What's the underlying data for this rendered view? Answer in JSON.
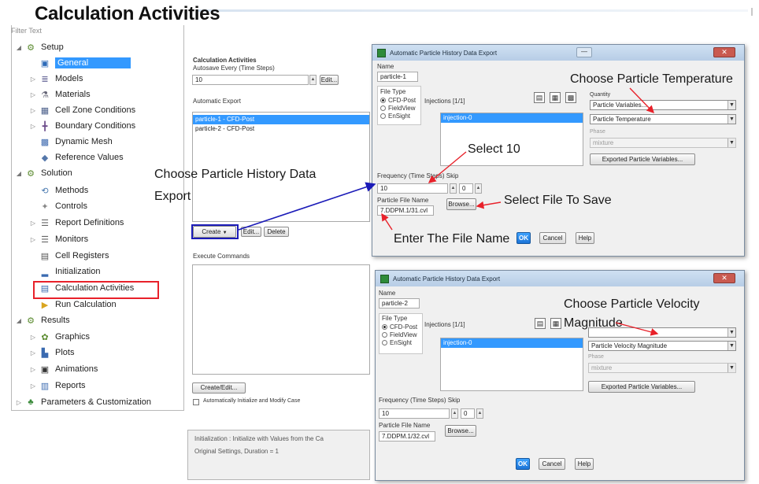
{
  "slide": {
    "title": "Calculation Activities"
  },
  "tree": {
    "filter_text": "Filter Text",
    "items": [
      {
        "label": "Setup",
        "icon": "setup-icon"
      },
      {
        "label": "General",
        "icon": "general-icon"
      },
      {
        "label": "Models",
        "icon": "models-icon"
      },
      {
        "label": "Materials",
        "icon": "materials-icon"
      },
      {
        "label": "Cell Zone Conditions",
        "icon": "cell-zone-icon"
      },
      {
        "label": "Boundary Conditions",
        "icon": "boundary-icon"
      },
      {
        "label": "Dynamic Mesh",
        "icon": "dynamic-mesh-icon"
      },
      {
        "label": "Reference Values",
        "icon": "reference-values-icon"
      },
      {
        "label": "Solution",
        "icon": "solution-icon"
      },
      {
        "label": "Methods",
        "icon": "methods-icon"
      },
      {
        "label": "Controls",
        "icon": "controls-icon"
      },
      {
        "label": "Report Definitions",
        "icon": "report-definitions-icon"
      },
      {
        "label": "Monitors",
        "icon": "monitors-icon"
      },
      {
        "label": "Cell Registers",
        "icon": "cell-registers-icon"
      },
      {
        "label": "Initialization",
        "icon": "initialization-icon"
      },
      {
        "label": "Calculation Activities",
        "icon": "calculation-activities-icon"
      },
      {
        "label": "Run Calculation",
        "icon": "run-calculation-icon"
      },
      {
        "label": "Results",
        "icon": "results-icon"
      },
      {
        "label": "Graphics",
        "icon": "graphics-icon"
      },
      {
        "label": "Plots",
        "icon": "plots-icon"
      },
      {
        "label": "Animations",
        "icon": "animations-icon"
      },
      {
        "label": "Reports",
        "icon": "reports-icon"
      },
      {
        "label": "Parameters & Customization",
        "icon": "parameters-icon"
      }
    ]
  },
  "calc_panel": {
    "heading": "Calculation Activities",
    "autosave_label": "Autosave Every (Time Steps)",
    "autosave_value": "10",
    "edit_label": "Edit...",
    "automatic_export_label": "Automatic Export",
    "export_items": [
      "particle-1 - CFD-Post",
      "particle-2 - CFD-Post"
    ],
    "create_label": "Create",
    "edit2_label": "Edit...",
    "delete_label": "Delete",
    "execute_commands_label": "Execute Commands",
    "create_edit_label": "Create/Edit...",
    "auto_init_label": "Automatically Initialize and Modify Case",
    "info_line1": "Initialization : Initialize with Values from the Ca",
    "info_line2": "Original Settings, Duration = 1"
  },
  "dialog1": {
    "title": "Automatic Particle History Data Export",
    "name_label": "Name",
    "name_value": "particle-1",
    "file_type_label": "File Type",
    "file_types": [
      "CFD-Post",
      "FieldView",
      "EnSight"
    ],
    "injections_label": "Injections [1/1]",
    "injection_item": "injection-0",
    "quantity_label": "Quantity",
    "quantity_value": "Particle Variables...",
    "variable_value": "Particle Temperature",
    "phase_label": "Phase",
    "phase_value": "mixture",
    "exported_btn": "Exported Particle Variables...",
    "frequency_label": "Frequency (Time Steps) Skip",
    "frequency_value": "10",
    "skip_value": "0",
    "file_name_label": "Particle File Name",
    "file_name_value": "7.DDPM.1/31.cvl",
    "browse_label": "Browse...",
    "ok_label": "OK",
    "cancel_label": "Cancel",
    "help_label": "Help"
  },
  "dialog2": {
    "title": "Automatic Particle History Data Export",
    "name_label": "Name",
    "name_value": "particle-2",
    "file_type_label": "File Type",
    "file_types": [
      "CFD-Post",
      "FieldView",
      "EnSight"
    ],
    "injections_label": "Injections [1/1]",
    "injection_item": "injection-0",
    "variable_value": "Particle Velocity Magnitude",
    "phase_label": "Phase",
    "phase_value": "mixture",
    "exported_btn": "Exported Particle Variables...",
    "frequency_label": "Frequency (Time Steps) Skip",
    "frequency_value": "10",
    "skip_value": "0",
    "file_name_label": "Particle File Name",
    "file_name_value": "7.DDPM.1/32.cvl",
    "browse_label": "Browse...",
    "ok_label": "OK",
    "cancel_label": "Cancel",
    "help_label": "Help"
  },
  "annotations": {
    "choose_export_line1": "Choose Particle History Data",
    "choose_export_line2": "Export",
    "choose_temperature": "Choose Particle Temperature",
    "select_10": "Select 10",
    "select_file": "Select File To Save",
    "enter_file_name": "Enter The File Name",
    "choose_velocity_line1": "Choose Particle Velocity",
    "choose_velocity_line2": "Magnitude"
  },
  "colors": {
    "selection": "#3399ff",
    "highlight_red": "#e8212a",
    "arrow_blue": "#1b1bb8",
    "arrow_red": "#e8212a"
  }
}
